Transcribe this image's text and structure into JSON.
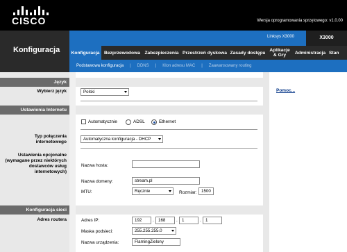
{
  "header": {
    "logo_text": "CISCO",
    "firmware": "Wersja oprogramowania sprzętowego: v1.0.00"
  },
  "page_title": "Konfiguracja",
  "model": {
    "name": "Linksys X3000",
    "short": "X3000"
  },
  "tabs": [
    {
      "label": "Konfiguracja",
      "active": true
    },
    {
      "label": "Bezprzewodowa",
      "active": false
    },
    {
      "label": "Zabezpieczenia",
      "active": false
    },
    {
      "label": "Przestrzeń dyskowa",
      "active": false
    },
    {
      "label": "Zasady dostępu",
      "active": false
    },
    {
      "label": "Aplikacje & Gry",
      "active": false
    },
    {
      "label": "Administracja",
      "active": false
    },
    {
      "label": "Stan",
      "active": false
    }
  ],
  "subtabs": [
    {
      "label": "Podstawowa konfiguracja",
      "active": true
    },
    {
      "label": "DDNS",
      "active": false
    },
    {
      "label": "Klon adresu MAC",
      "active": false
    },
    {
      "label": "Zaawansowany routing",
      "active": false
    }
  ],
  "sections": {
    "language": {
      "header": "Język",
      "label": "Wybierz język",
      "value": "Polski"
    },
    "internet": {
      "header": "Ustawienia Internetu",
      "connection_type_label": "Typ połączenia internetowego",
      "checkbox_auto": "Automatycznie",
      "radio_adsl": "ADSL",
      "radio_ethernet": "Ethernet",
      "connection_value": "Automatyczna konfiguracja - DHCP",
      "optional_label": "Ustawienia opcjonalne (wymagane przez niektórych dostawców usług internetowych)",
      "host_name_label": "Nazwa hosta:",
      "host_name_value": "",
      "domain_label": "Nazwa domeny:",
      "domain_value": "stream.pl",
      "mtu_label": "MTU:",
      "mtu_value": "Ręcznie",
      "size_label": "Rozmiar:",
      "size_value": "1500"
    },
    "network": {
      "header": "Konfiguracja sieci",
      "router_address_label": "Adres routera",
      "ip_label": "Adres IP:",
      "ip": [
        "192",
        "168",
        "1",
        "1"
      ],
      "mask_label": "Maska podsieci:",
      "mask_value": "255.255.255.0",
      "device_name_label": "Nazwa urządzenia:",
      "device_name_value": "FlamingZielony"
    }
  },
  "help": {
    "link": "Pomoc..."
  },
  "colors": {
    "accent_blue": "#1d6fc0",
    "dark": "#2a2a2a",
    "section_gray": "#6b6b6b"
  }
}
